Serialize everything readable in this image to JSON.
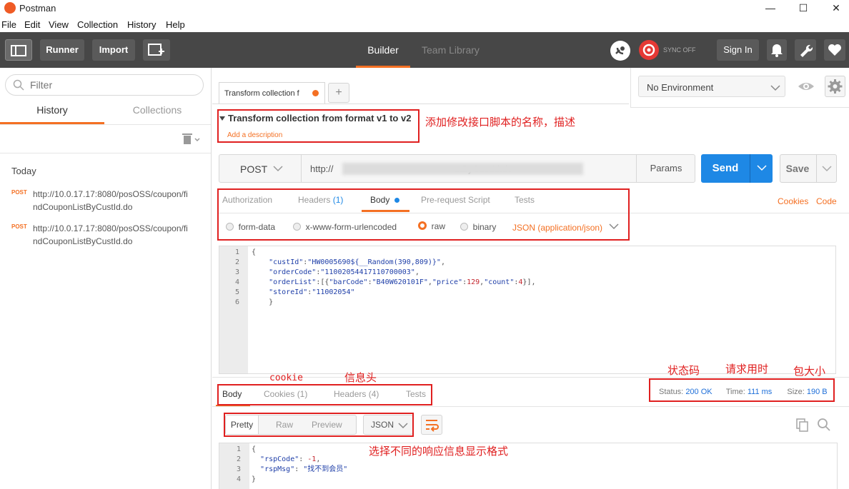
{
  "window": {
    "title": "Postman",
    "minimize": "—",
    "maximize": "☐",
    "close": "✕"
  },
  "menu": [
    "File",
    "Edit",
    "View",
    "Collection",
    "History",
    "Help"
  ],
  "toolbar": {
    "runner": "Runner",
    "import": "Import",
    "builder": "Builder",
    "team_library": "Team Library",
    "sync": "SYNC OFF",
    "sign_in": "Sign In"
  },
  "sidebar": {
    "filter_placeholder": "Filter",
    "tab_history": "History",
    "tab_collections": "Collections",
    "group_label": "Today",
    "items": [
      {
        "method": "POST",
        "url": "http://10.0.17.17:8080/posOSS/coupon/findCouponListByCustId.do"
      },
      {
        "method": "POST",
        "url": "http://10.0.17.17:8080/posOSS/coupon/findCouponListByCustId.do"
      }
    ]
  },
  "request_tab": {
    "label": "Transform collection f",
    "add": "+"
  },
  "environment": {
    "selected": "No Environment"
  },
  "request": {
    "name": "Transform collection from format v1 to v2",
    "add_description": "Add a description",
    "method": "POST",
    "url": "http://                                               stByCustId.do",
    "params": "Params",
    "send": "Send",
    "save": "Save"
  },
  "req_tabs": {
    "authorization": "Authorization",
    "headers": "Headers",
    "headers_count": "(1)",
    "body": "Body",
    "pre_request": "Pre-request Script",
    "tests": "Tests",
    "cookies": "Cookies",
    "code": "Code"
  },
  "body_modes": {
    "form_data": "form-data",
    "urlencoded": "x-www-form-urlencoded",
    "raw": "raw",
    "binary": "binary",
    "content_type": "JSON (application/json)"
  },
  "request_body": {
    "line_numbers": [
      "1",
      "2",
      "3",
      "4",
      "5",
      "6"
    ],
    "lines": [
      "{",
      "    \"custId\":\"HW0005690${__Random(390,809)}\",",
      "    \"orderCode\":\"11002054417110700003\",",
      "    \"orderList\":[{\"barCode\":\"B40W620101F\",\"price\":129,\"count\":4}],",
      "    \"storeId\":\"11002054\"",
      "    }"
    ]
  },
  "response_tabs": {
    "body": "Body",
    "cookies": "Cookies (1)",
    "headers": "Headers (4)",
    "tests": "Tests"
  },
  "response_meta": {
    "status_label": "Status:",
    "status_value": "200 OK",
    "time_label": "Time:",
    "time_value": "111 ms",
    "size_label": "Size:",
    "size_value": "190 B"
  },
  "view_modes": {
    "pretty": "Pretty",
    "raw": "Raw",
    "preview": "Preview",
    "format": "JSON"
  },
  "response_body": {
    "line_numbers": [
      "1",
      "2",
      "3",
      "4"
    ],
    "lines": [
      "{",
      "  \"rspCode\": -1,",
      "  \"rspMsg\": \"找不到会员\"",
      "}"
    ]
  },
  "annotations": {
    "name_desc": "添加修改接口脚本的名称，描述",
    "cookie": "cookie",
    "headers": "信息头",
    "status": "状态码",
    "time": "请求用时",
    "size": "包大小",
    "format": "选择不同的响应信息显示格式"
  },
  "colors": {
    "accent": "#f47023",
    "send": "#1e88e5",
    "toolbar": "#474747",
    "annotation": "#e02020",
    "status": "#1e6fd9"
  }
}
